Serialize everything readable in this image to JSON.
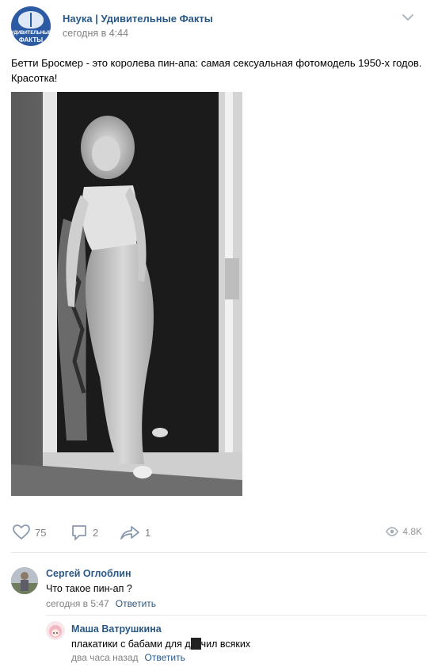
{
  "group": {
    "name": "Наука | Удивительные Факты",
    "time": "сегодня в 4:44",
    "logo_text_line1": "УДИВИТЕЛЬНЫЕ",
    "logo_text_line2": "ФАКТЫ"
  },
  "post": {
    "text": "Бетти Бросмер - это королева пин-апа: самая сексуальная фотомодель 1950-х годов. Красотка!"
  },
  "actions": {
    "likes": "75",
    "comments": "2",
    "shares": "1",
    "views": "4.8K"
  },
  "comments": [
    {
      "author": "Сергей Оглоблин",
      "text": "Что такое пин-ап ?",
      "time": "сегодня в 5:47",
      "reply": "Ответить"
    },
    {
      "author": "Маша Ватрушкина",
      "text_before": "плакатики с бабами для д",
      "text_after": "чил всяких",
      "time": "два часа назад",
      "reply": "Ответить"
    }
  ],
  "colors": {
    "link": "#2a5885",
    "meta": "#828282",
    "divider": "#e7e8ec",
    "group_logo": "#2c5aa3"
  }
}
